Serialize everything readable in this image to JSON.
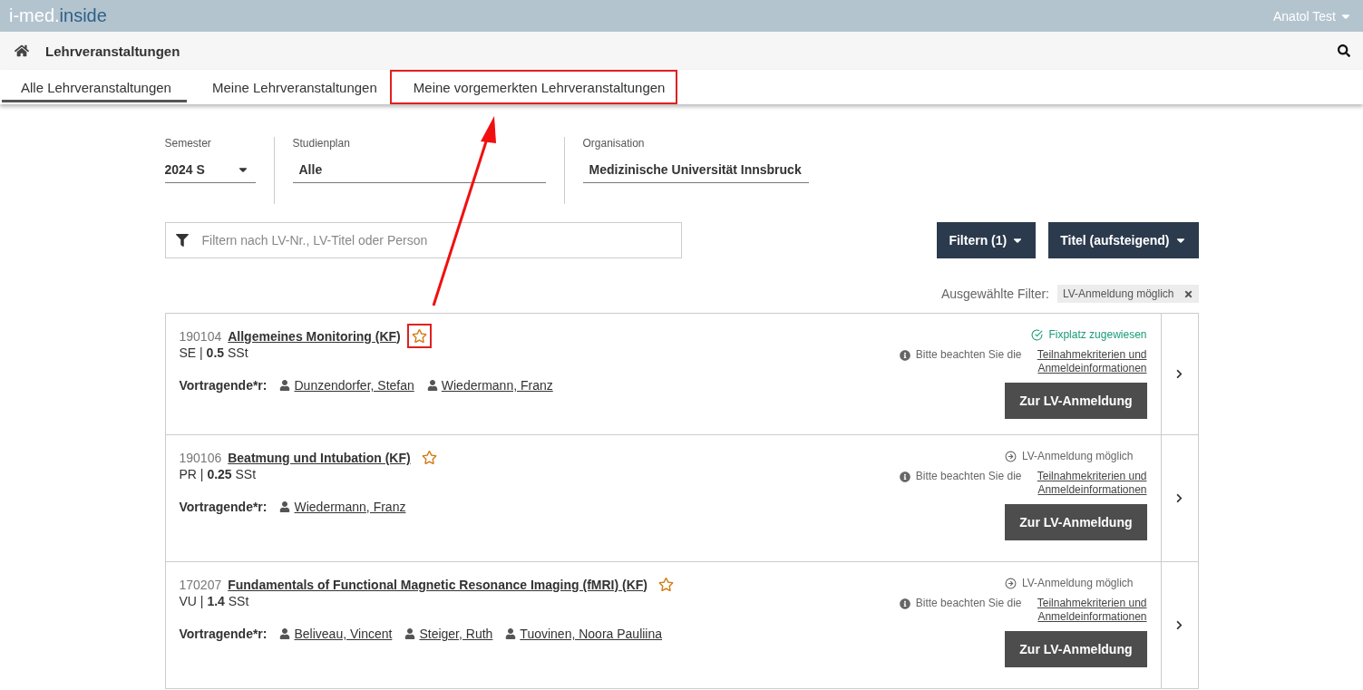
{
  "header": {
    "logo_left": "i-med.",
    "logo_right": "inside",
    "user": "Anatol Test"
  },
  "subheader": {
    "title": "Lehrveranstaltungen"
  },
  "tabs": [
    {
      "label": "Alle Lehrveranstaltungen",
      "selected": true,
      "highlighted": false
    },
    {
      "label": "Meine Lehrveranstaltungen",
      "selected": false,
      "highlighted": false
    },
    {
      "label": "Meine vorgemerkten Lehrveranstaltungen",
      "selected": false,
      "highlighted": true
    }
  ],
  "selectors": [
    {
      "label": "Semester",
      "value": "2024 S",
      "kind": "dropdown"
    },
    {
      "label": "Studienplan",
      "value": "Alle",
      "kind": "text"
    },
    {
      "label": "Organisation",
      "value": "Medizinische Universität Innsbruck",
      "kind": "text"
    }
  ],
  "search": {
    "placeholder": "Filtern nach LV-Nr., LV-Titel oder Person"
  },
  "buttons": [
    "Filtern (1)",
    "Titel (aufsteigend)"
  ],
  "active_filters": {
    "label": "Ausgewählte Filter:",
    "tags": [
      "LV-Anmeldung möglich"
    ]
  },
  "courses": [
    {
      "number": "190104",
      "title": "Allgemeines Monitoring (KF)",
      "star_highlighted": true,
      "meta": "SE | **0.5** SSt",
      "lecturers_label": "Vortragende*r:",
      "lecturers": [
        "Dunzendorfer, Stefan",
        "Wiedermann, Franz"
      ],
      "status": {
        "kind": "assigned",
        "text": "Fixplatz zugewiesen"
      },
      "note": "Bitte beachten Sie die",
      "note_link": "Teilnahmekriterien und Anmeldeinformationen",
      "action": "Zur LV-Anmeldung"
    },
    {
      "number": "190106",
      "title": "Beatmung und Intubation (KF)",
      "star_highlighted": false,
      "meta": "PR | **0.25** SSt",
      "lecturers_label": "Vortragende*r:",
      "lecturers": [
        "Wiedermann, Franz"
      ],
      "status": {
        "kind": "possible",
        "text": "LV-Anmeldung möglich"
      },
      "note": "Bitte beachten Sie die",
      "note_link": "Teilnahmekriterien und Anmeldeinformationen",
      "action": "Zur LV-Anmeldung"
    },
    {
      "number": "170207",
      "title": "Fundamentals of Functional Magnetic Resonance Imaging (fMRI) (KF)",
      "star_highlighted": false,
      "meta": "VU | **1.4** SSt",
      "lecturers_label": "Vortragende*r:",
      "lecturers": [
        "Beliveau, Vincent",
        "Steiger, Ruth",
        "Tuovinen, Noora Pauliina"
      ],
      "status": {
        "kind": "possible",
        "text": "LV-Anmeldung möglich"
      },
      "note": "Bitte beachten Sie die",
      "note_link": "Teilnahmekriterien und Anmeldeinformationen",
      "action": "Zur LV-Anmeldung"
    }
  ],
  "annotation_arrow": {
    "shown": true
  }
}
